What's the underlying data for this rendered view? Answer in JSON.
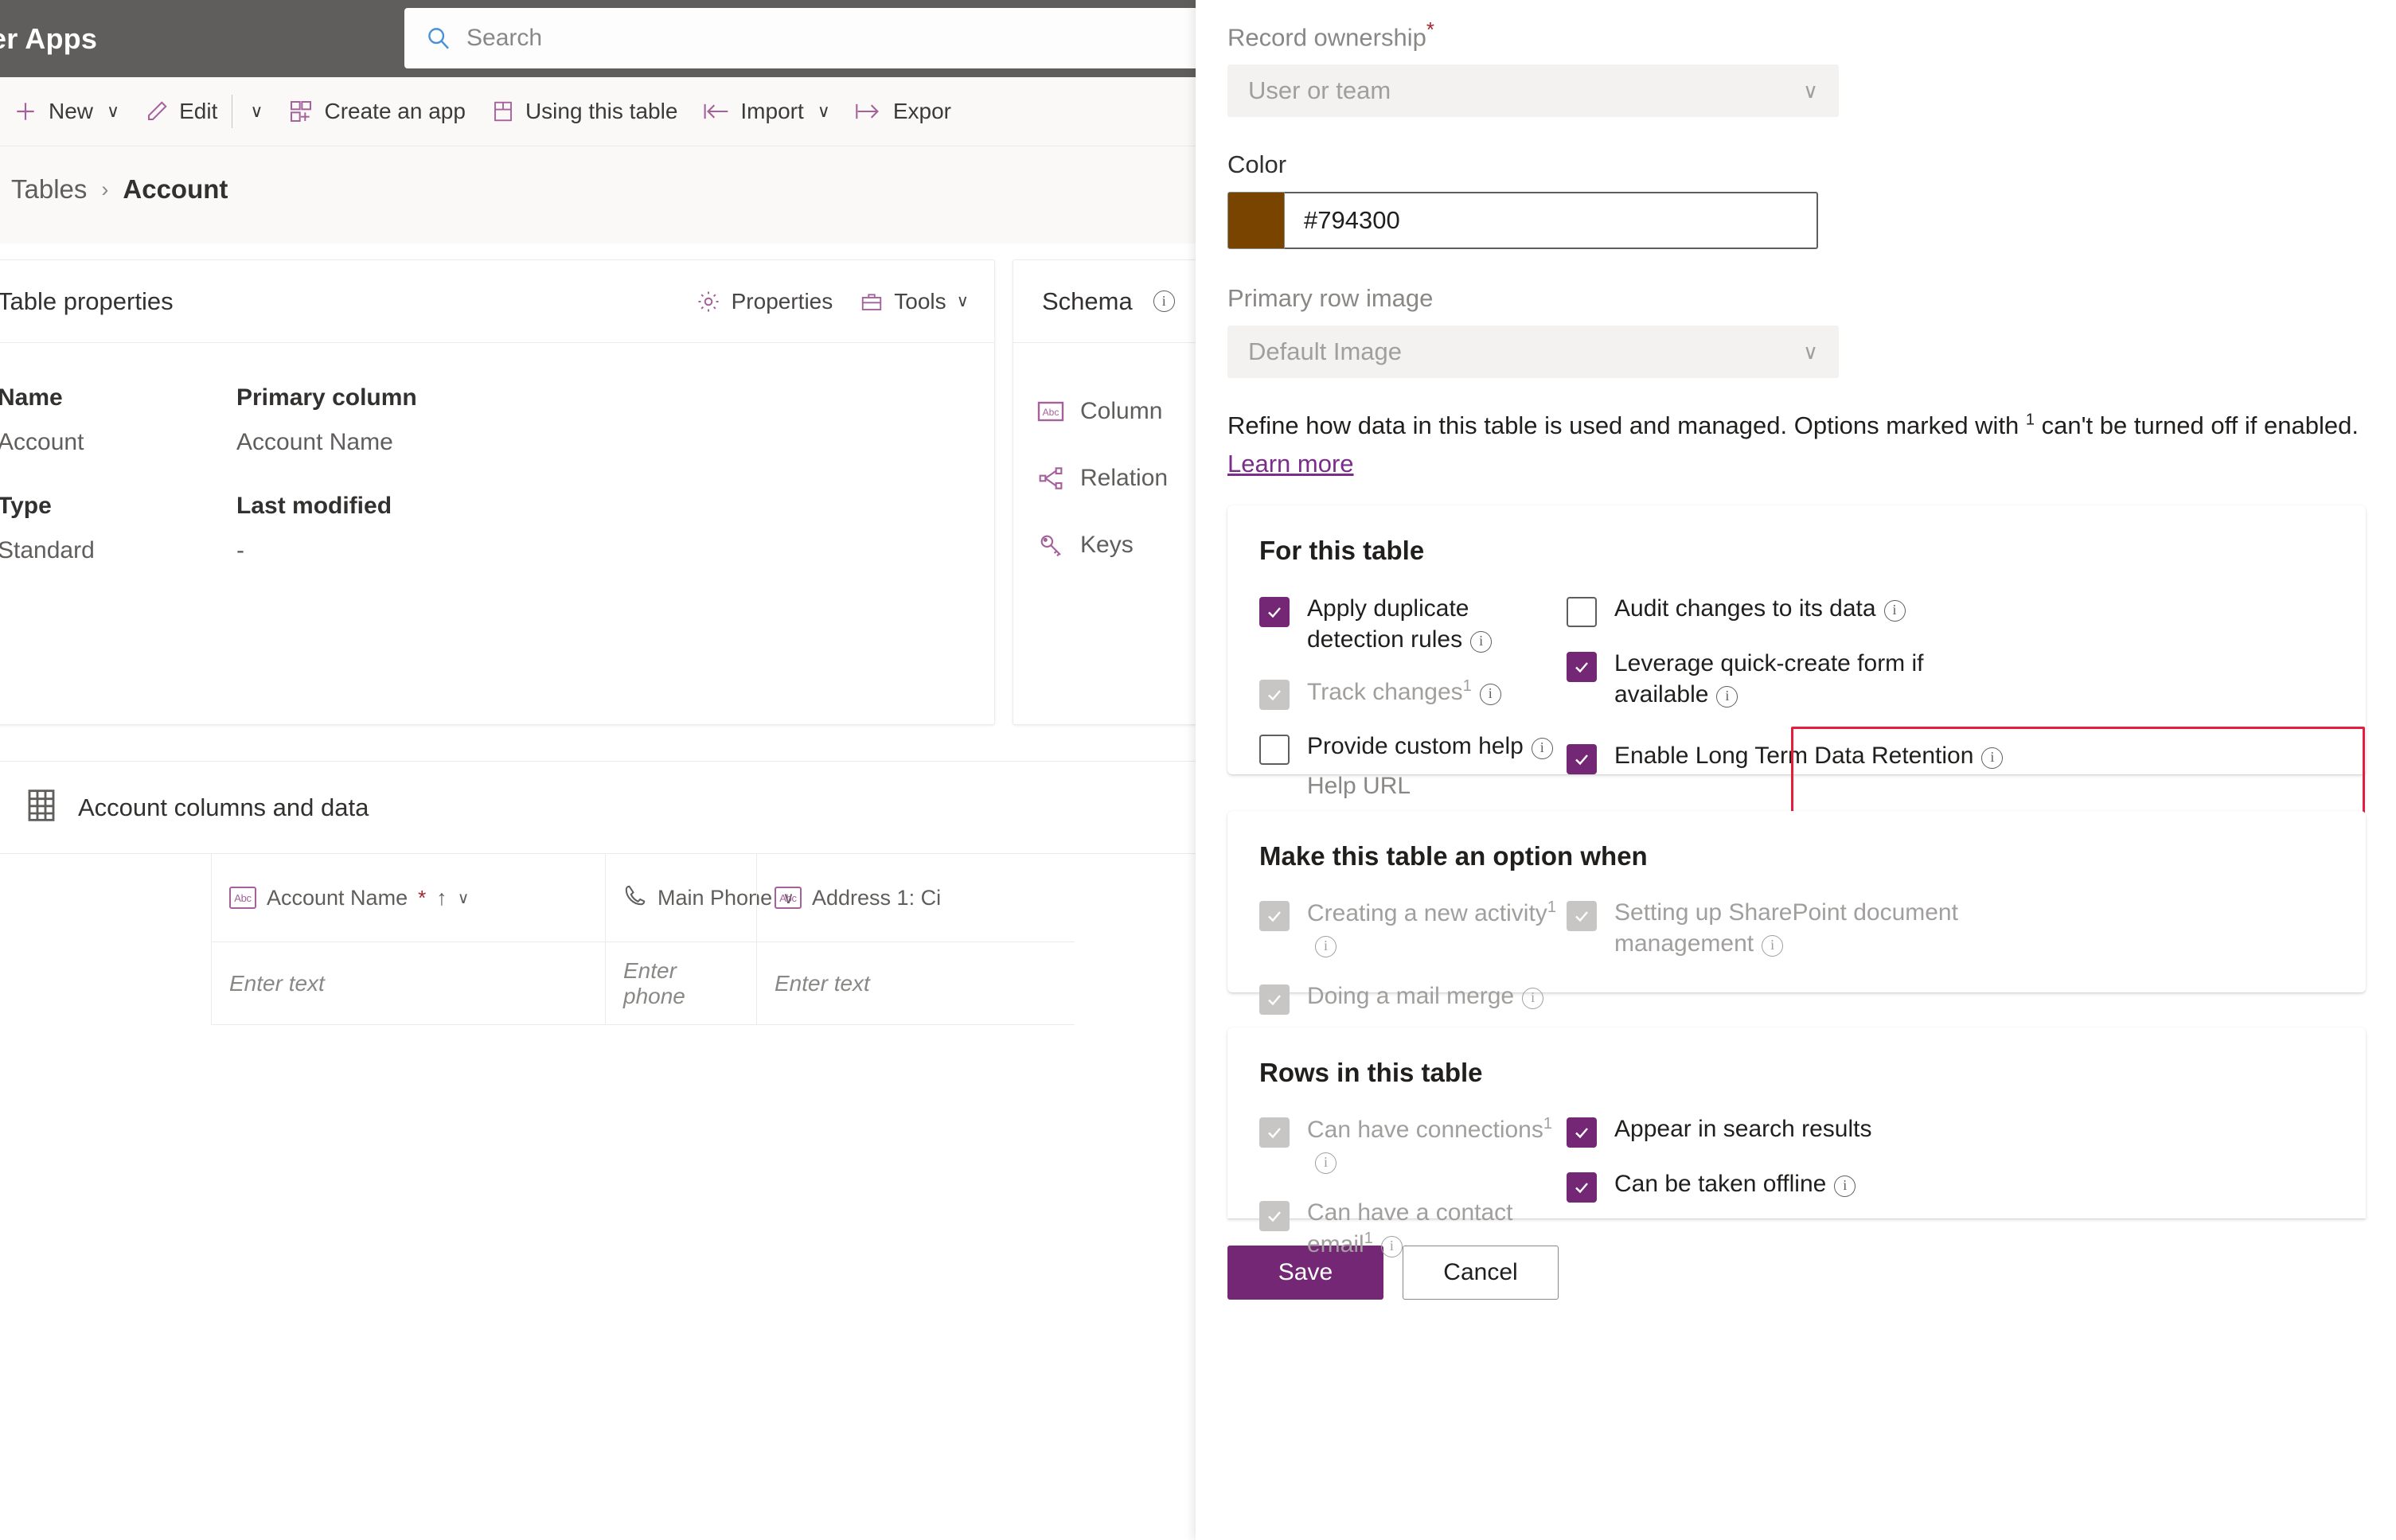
{
  "header": {
    "brand": "er Apps",
    "search": {
      "placeholder": "Search",
      "icon": "search-icon"
    }
  },
  "commandbar": {
    "items": [
      {
        "label": "New",
        "icon": "plus-icon",
        "chevron": "∨"
      },
      {
        "label": "Edit",
        "icon": "pencil-icon",
        "chevron": "∨"
      },
      {
        "label": "Create an app",
        "icon": "app-grid-icon",
        "chevron": ""
      },
      {
        "label": "Using this table",
        "icon": "table-icon",
        "chevron": ""
      },
      {
        "label": "Import",
        "icon": "import-arrow-icon",
        "chevron": "∨"
      },
      {
        "label": "Expor",
        "icon": "export-arrow-icon",
        "chevron": ""
      }
    ]
  },
  "breadcrumb": {
    "parent": "Tables",
    "separator": "›",
    "current": "Account"
  },
  "table_properties": {
    "title": "Table properties",
    "actions": [
      {
        "label": "Properties",
        "icon": "gear-icon"
      },
      {
        "label": "Tools",
        "icon": "toolbox-icon",
        "chevron": "∨"
      }
    ],
    "fields": [
      {
        "header": "Name",
        "value": "Account"
      },
      {
        "header": "Primary column",
        "value": "Account Name"
      },
      {
        "header": "Type",
        "value": "Standard"
      },
      {
        "header": "Last modified",
        "value": "-"
      }
    ]
  },
  "schema": {
    "title": "Schema",
    "info_icon": "info-icon",
    "items": [
      {
        "label": "Column",
        "icon": "abc-column-icon"
      },
      {
        "label": "Relation",
        "icon": "relationships-icon"
      },
      {
        "label": "Keys",
        "icon": "key-icon"
      }
    ]
  },
  "columns_and_data": {
    "title": "Account columns and data",
    "icon": "grid-table-icon",
    "columns": [
      {
        "label": "Account Name",
        "icon": "abc-icon",
        "required": "*",
        "sort": "↑",
        "chevron": "∨",
        "placeholder": "Enter text"
      },
      {
        "label": "Main Phone",
        "icon": "phone-icon",
        "required": "",
        "sort": "",
        "chevron": "∨",
        "placeholder": "Enter phone"
      },
      {
        "label": "Address 1: Ci",
        "icon": "abc-icon",
        "required": "",
        "sort": "",
        "chevron": "",
        "placeholder": "Enter text"
      }
    ]
  },
  "panel": {
    "record_ownership": {
      "label": "Record ownership",
      "required": "*",
      "value": "User or team",
      "chevron": "∨"
    },
    "color": {
      "label": "Color",
      "value": "#794300",
      "swatch_hex": "#794300"
    },
    "primary_row_image": {
      "label": "Primary row image",
      "value": "Default Image",
      "chevron": "∨"
    },
    "refine": {
      "text_before": "Refine how data in this table is used and managed. Options marked with ",
      "superscript": "1",
      "text_after": " can't be turned off if enabled. ",
      "link": "Learn more"
    },
    "for_this_table": {
      "title": "For this table",
      "left": [
        {
          "label": "Apply duplicate detection rules",
          "state": "checked",
          "info": true,
          "sup": ""
        },
        {
          "label": "Track changes",
          "state": "locked",
          "info": true,
          "sup": "1"
        },
        {
          "label": "Provide custom help",
          "state": "unchecked",
          "info": true,
          "sup": ""
        }
      ],
      "right": [
        {
          "label": "Audit changes to its data",
          "state": "unchecked",
          "info": true,
          "sup": ""
        },
        {
          "label": "Leverage quick-create form if available",
          "state": "checked",
          "info": true,
          "sup": ""
        },
        {
          "label": "Enable Long Term Data Retention",
          "state": "checked",
          "info": true,
          "sup": "",
          "highlighted": true
        }
      ],
      "help_url_label": "Help URL"
    },
    "option_when": {
      "title": "Make this table an option when",
      "left": [
        {
          "label": "Creating a new activity",
          "state": "locked",
          "info": true,
          "sup": "1"
        },
        {
          "label": "Doing a mail merge",
          "state": "locked",
          "info": true,
          "sup": ""
        }
      ],
      "right": [
        {
          "label": "Setting up SharePoint document management",
          "state": "locked",
          "info": true,
          "sup": ""
        }
      ]
    },
    "rows_in_table": {
      "title": "Rows in this table",
      "left": [
        {
          "label": "Can have connections",
          "state": "locked",
          "info": true,
          "sup": "1"
        },
        {
          "label": "Can have a contact email",
          "state": "locked",
          "info": true,
          "sup": "1"
        }
      ],
      "right": [
        {
          "label": "Appear in search results",
          "state": "checked",
          "info": false,
          "sup": ""
        },
        {
          "label": "Can be taken offline",
          "state": "checked",
          "info": true,
          "sup": ""
        }
      ]
    },
    "footer": {
      "save": "Save",
      "cancel": "Cancel"
    }
  },
  "colors": {
    "accent_purple": "#742774",
    "icon_purple": "#a4619a",
    "highlight_red": "#e81d3d",
    "chrome_gray": "#605e5c",
    "swatch_brown": "#794300"
  }
}
